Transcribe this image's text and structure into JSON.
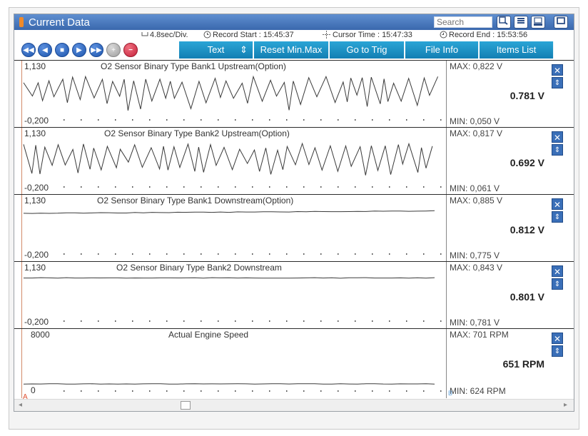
{
  "window": {
    "title": "Current Data",
    "search_placeholder": "Search"
  },
  "titlebar_icons": [
    "zoom-icon",
    "list-icon",
    "retry-icon",
    "maximize-icon"
  ],
  "info": {
    "division": "4.8sec/Div.",
    "record_start": "Record Start : 15:45:37",
    "cursor_time": "Cursor Time : 15:47:33",
    "record_end": "Record End : 15:53:56"
  },
  "toolbar": {
    "playback_icons": [
      "rewind-icon",
      "step-back-icon",
      "stop-icon",
      "play-icon",
      "fast-forward-icon",
      "zoom-in-icon",
      "zoom-out-icon"
    ],
    "glyphs": {
      "rewind": "◀◀",
      "back": "◀",
      "stop": "■",
      "play": "▶",
      "ff": "▶▶",
      "plus": "+",
      "minus": "−",
      "close": "✕",
      "updown": "⇕",
      "scroll_left": "◂",
      "scroll_right": "▸"
    },
    "text_label": "Text",
    "text_spin": "⇕",
    "reset_label": "Reset Min.Max",
    "trig_label": "Go to Trig",
    "file_label": "File Info",
    "items_label": "Items List"
  },
  "panels": [
    {
      "title": "O2 Sensor Binary Type Bank1 Upstream(Option)",
      "ymax": "1,130",
      "ymin": "-0,200",
      "max": "MAX: 0,822 V",
      "min": "MIN: 0,050 V",
      "value": "0.781 V"
    },
    {
      "title": "O2 Sensor Binary Type Bank2 Upstream(Option)",
      "ymax": "1,130",
      "ymin": "-0,200",
      "max": "MAX: 0,817 V",
      "min": "MIN: 0,061 V",
      "value": "0.692 V"
    },
    {
      "title": "O2 Sensor Binary Type Bank1 Downstream(Option)",
      "ymax": "1,130",
      "ymin": "-0,200",
      "max": "MAX: 0,885 V",
      "min": "MIN: 0,775 V",
      "value": "0.812 V"
    },
    {
      "title": "O2 Sensor Binary Type Bank2 Downstream",
      "ymax": "1,130",
      "ymin": "-0,200",
      "max": "MAX: 0,843 V",
      "min": "MIN: 0,781 V",
      "value": "0.801 V"
    },
    {
      "title": "Actual Engine Speed",
      "ymax": "8000",
      "ymin": "0",
      "max": "MAX:   701 RPM",
      "min": "MIN:   624 RPM",
      "value": "651 RPM"
    }
  ],
  "cursors": {
    "a": "A",
    "b": "B"
  }
}
